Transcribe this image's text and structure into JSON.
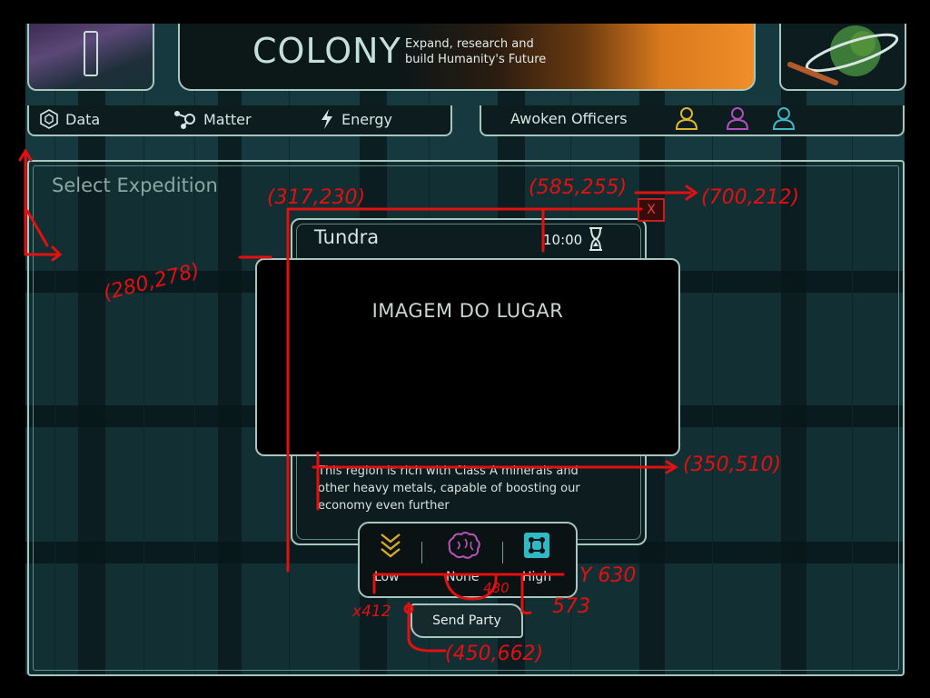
{
  "header": {
    "title": "COLONY",
    "subtitle_line1": "Expand, research and",
    "subtitle_line2": "build Humanity's Future"
  },
  "tabs": [
    {
      "label": "Data",
      "icon": "cube-icon"
    },
    {
      "label": "Matter",
      "icon": "molecule-icon"
    },
    {
      "label": "Energy",
      "icon": "lightning-icon"
    }
  ],
  "officers": {
    "label": "Awoken Officers",
    "colors": [
      "#e0b631",
      "#b04fc0",
      "#3fb6c2"
    ]
  },
  "panel": {
    "heading": "Select Expedition"
  },
  "expedition": {
    "name": "Tundra",
    "time": "10:00",
    "image_label": "IMAGEM DO LUGAR",
    "description_line1": "This region is rich with Class A minerals and",
    "description_line2": "other heavy metals,  capable of boosting our",
    "description_line3": "economy even further",
    "close_label": "X"
  },
  "requirements": [
    {
      "icon": "rank-chevrons-icon",
      "label": "Low",
      "color": "#d9a92d"
    },
    {
      "icon": "brain-icon",
      "label": "None",
      "color": "#b653b8"
    },
    {
      "icon": "circuit-icon",
      "label": "High",
      "color": "#2fb9c4"
    }
  ],
  "send_button": "Send Party",
  "annotations": {
    "a1": "(317,230)",
    "a2": "(585,255)",
    "a3": "(700,212)",
    "a4": "(280,278)",
    "a5": "(350,510)",
    "a6": "Y 630",
    "a7": "x412",
    "a8": "480",
    "a9": "573",
    "a10": "(450,662)"
  }
}
